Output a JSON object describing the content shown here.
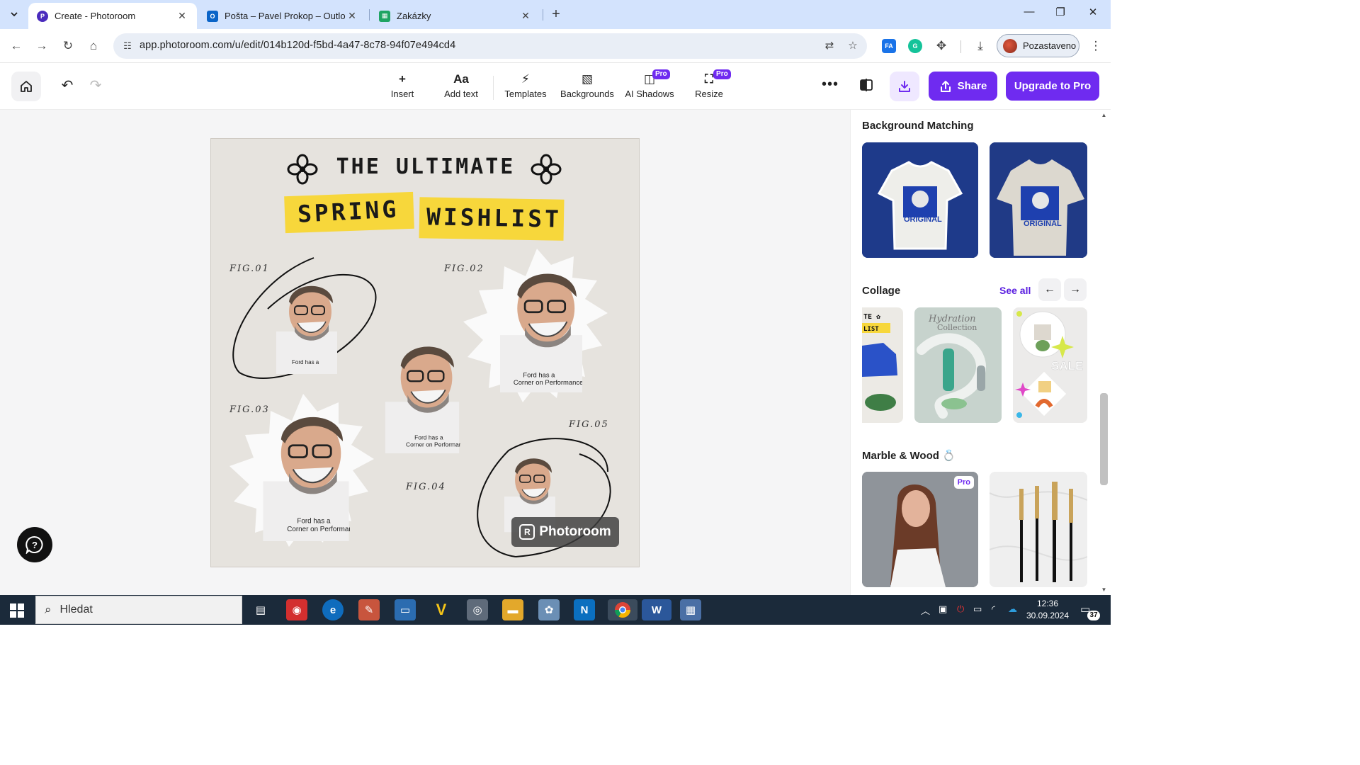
{
  "browser": {
    "tabs": [
      {
        "title": "Create - Photoroom",
        "active": true
      },
      {
        "title": "Pošta – Pavel Prokop – Outlook",
        "active": false
      },
      {
        "title": "Zakázky",
        "active": false
      }
    ],
    "close_glyph": "✕",
    "new_tab_glyph": "+",
    "url": "app.photoroom.com/u/edit/014b120d-f5bd-4a47-8c78-94f07e494cd4",
    "profile_label": "Pozastaveno",
    "extensions": [
      {
        "label": "FA",
        "color": "#1a73e8"
      },
      {
        "label": "G",
        "color": "#15c39a"
      }
    ]
  },
  "app": {
    "toolbar": {
      "insert": "Insert",
      "add_text": "Add text",
      "add_text_icon": "Aa",
      "templates": "Templates",
      "backgrounds": "Backgrounds",
      "ai_shadows": "AI Shadows",
      "resize": "Resize",
      "pro_badge": "Pro"
    },
    "share_label": "Share",
    "upgrade_label": "Upgrade to Pro",
    "accent_color": "#6f2bf0"
  },
  "canvas": {
    "title_line": "THE ULTIMATE",
    "tape_left": "SPRING",
    "tape_right": "WISHLIST",
    "figures": [
      "FIG.01",
      "FIG.02",
      "FIG.03",
      "FIG.04",
      "FIG.05"
    ],
    "shirt_text_line1": "Ford has a",
    "shirt_text_line2": "Corner on Performance",
    "watermark": "Photoroom",
    "watermark_logo": "R"
  },
  "panel": {
    "sections": {
      "background_matching": "Background Matching",
      "collage": "Collage",
      "marble_wood": "Marble & Wood",
      "marble_emoji": "💍"
    },
    "see_all": "See all",
    "tshirt_label": "ORIGINAL",
    "collage_thumb_text": "Hydration Collection",
    "collage_thumb_sale": "SALE",
    "collage_partial_top": "TE ✿",
    "collage_partial_mid": "LIST",
    "pro_badge": "Pro"
  },
  "taskbar": {
    "search_placeholder": "Hledat",
    "time": "12:36",
    "date": "30.09.2024",
    "notification_count": "37"
  }
}
